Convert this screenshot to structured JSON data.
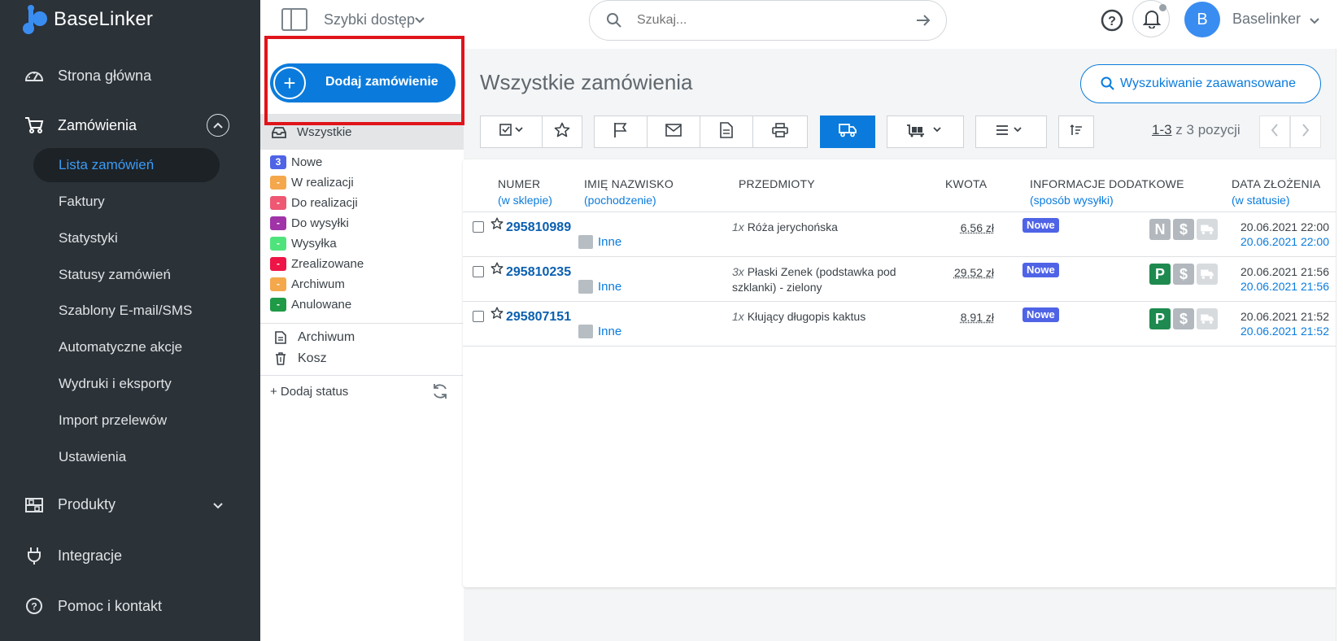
{
  "app": {
    "logo_text": "BaseLinker"
  },
  "sidebar": {
    "home": "Strona główna",
    "orders": "Zamówienia",
    "orders_sub": [
      "Lista zamówień",
      "Faktury",
      "Statystyki",
      "Statusy zamówień",
      "Szablony E-mail/SMS",
      "Automatyczne akcje",
      "Wydruki i eksporty",
      "Import przelewów",
      "Ustawienia"
    ],
    "products": "Produkty",
    "integrations": "Integracje",
    "help": "Pomoc i kontakt"
  },
  "topbar": {
    "quick_access": "Szybki dostęp",
    "search_placeholder": "Szukaj...",
    "avatar_letter": "B",
    "user_name": "Baselinker"
  },
  "status_panel": {
    "add_order": "Dodaj zamówienie",
    "all": "Wszystkie",
    "statuses": [
      {
        "label": "Nowe",
        "count": "3",
        "color": "#4f63e6"
      },
      {
        "label": "W realizacji",
        "count": "-",
        "color": "#f4a84b"
      },
      {
        "label": "Do realizacji",
        "count": "-",
        "color": "#ee5873"
      },
      {
        "label": "Do wysyłki",
        "count": "-",
        "color": "#a033a8"
      },
      {
        "label": "Wysyłka",
        "count": "-",
        "color": "#4fe37c"
      },
      {
        "label": "Zrealizowane",
        "count": "-",
        "color": "#ee1446"
      },
      {
        "label": "Archiwum",
        "count": "-",
        "color": "#f4a84b"
      },
      {
        "label": "Anulowane",
        "count": "-",
        "color": "#1f9a47"
      }
    ],
    "archive": "Archiwum",
    "trash": "Kosz",
    "add_status": "+ Dodaj status"
  },
  "main": {
    "title": "Wszystkie zamówienia",
    "advanced_search": "Wyszukiwanie zaawansowane",
    "pager_range": "1-3",
    "pager_rest": " z 3 pozycji"
  },
  "table": {
    "headers": {
      "number": "NUMER",
      "number_sub": "(w sklepie)",
      "name": "IMIĘ NAZWISKO",
      "name_sub": "(pochodzenie)",
      "items": "PRZEDMIOTY",
      "amount": "KWOTA",
      "info": "INFORMACJE DODATKOWE",
      "info_sub": "(sposób wysyłki)",
      "date": "DATA ZŁOŻENIA",
      "date_sub": "(w statusie)"
    },
    "rows": [
      {
        "number": "295810989",
        "source": "Inne",
        "qty": "1x",
        "item": "Róża jerychońska",
        "amount": "6.56 zł",
        "status": "Nowe",
        "icon1": "N",
        "icon1_color": "#b2b8bd",
        "date": "20.06.2021 22:00",
        "status_date": "20.06.2021 22:00"
      },
      {
        "number": "295810235",
        "source": "Inne",
        "qty": "3x",
        "item": "Płaski Zenek (podstawka pod szklanki) - zielony",
        "amount": "29.52 zł",
        "status": "Nowe",
        "icon1": "P",
        "icon1_color": "#1e8a4f",
        "date": "20.06.2021 21:56",
        "status_date": "20.06.2021 21:56"
      },
      {
        "number": "295807151",
        "source": "Inne",
        "qty": "1x",
        "item": "Kłujący długopis kaktus",
        "amount": "8.91 zł",
        "status": "Nowe",
        "icon1": "P",
        "icon1_color": "#1e8a4f",
        "date": "20.06.2021 21:52",
        "status_date": "20.06.2021 21:52"
      }
    ]
  },
  "colors": {
    "accent": "#0a7bdc",
    "sidebar_bg": "#2b3238",
    "highlight_box": "#e0141b"
  }
}
